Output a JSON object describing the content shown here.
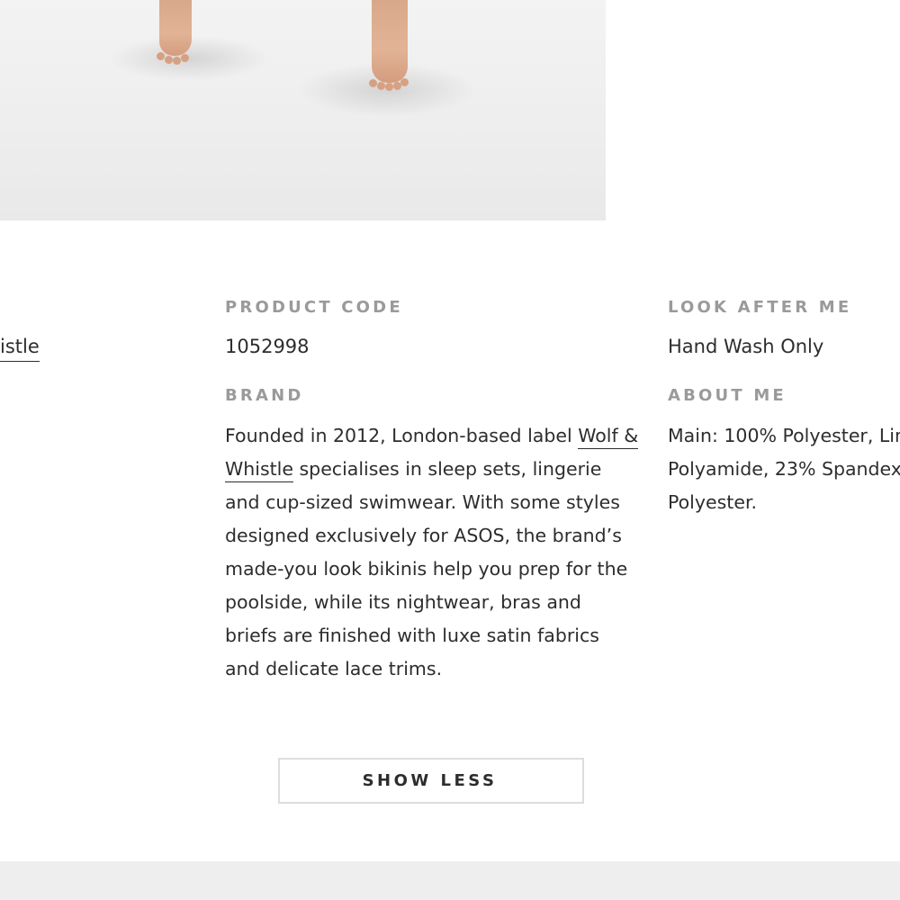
{
  "left_fragment": {
    "link_text": "istle"
  },
  "product_code": {
    "heading": "PRODUCT CODE",
    "value": "1052998"
  },
  "brand": {
    "heading": "BRAND",
    "text_before_link": "Founded in 2012, London-based label ",
    "link_text": "Wolf & Whistle",
    "text_after_link": " specialises in sleep sets, lingerie and cup-sized swimwear. With some styles designed exclusively for ASOS, the brand’s made-you look bikinis help you prep for the poolside, while its nightwear, bras and briefs are finished with luxe satin fabrics and delicate lace trims."
  },
  "look_after_me": {
    "heading": "LOOK AFTER ME",
    "value": "Hand Wash Only"
  },
  "about_me": {
    "heading": "ABOUT ME",
    "line1": "Main: 100% Polyester, Lin",
    "line2": "Polyamide, 23% Spandex",
    "line3": "Polyester."
  },
  "actions": {
    "show_less_label": "SHOW LESS"
  },
  "colors": {
    "heading_gray": "#9a9a9a",
    "text_dark": "#2d2d2d",
    "button_border": "#dddddd",
    "footer_bg": "#eeeeee"
  }
}
